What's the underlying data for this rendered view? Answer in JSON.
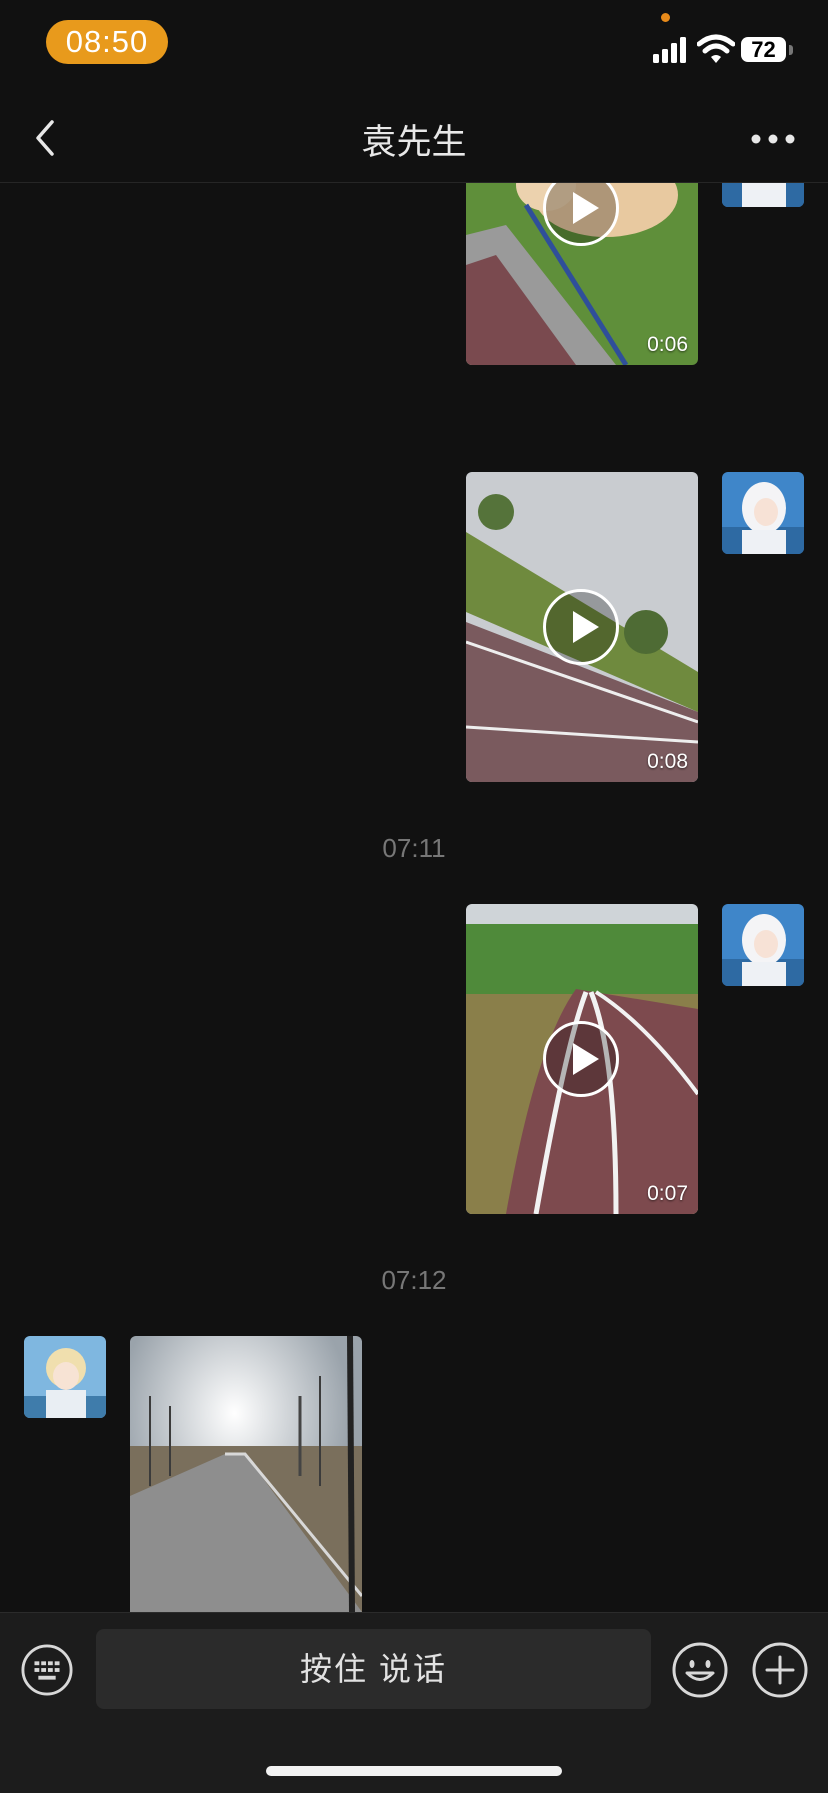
{
  "status_bar": {
    "time": "08:50",
    "battery": "72"
  },
  "header": {
    "title": "袁先生"
  },
  "chat": {
    "messages": [
      {
        "type": "video",
        "sender": "self",
        "duration": "0:06"
      },
      {
        "type": "video",
        "sender": "self",
        "duration": "0:08"
      },
      {
        "type": "timestamp",
        "text": "07:11"
      },
      {
        "type": "video",
        "sender": "self",
        "duration": "0:07"
      },
      {
        "type": "timestamp",
        "text": "07:12"
      },
      {
        "type": "image",
        "sender": "other"
      }
    ]
  },
  "input_bar": {
    "voice_label": "按住 说话"
  },
  "colors": {
    "background": "#111111",
    "time_pill": "#e89a1c",
    "input_bar": "#1c1c1c"
  }
}
